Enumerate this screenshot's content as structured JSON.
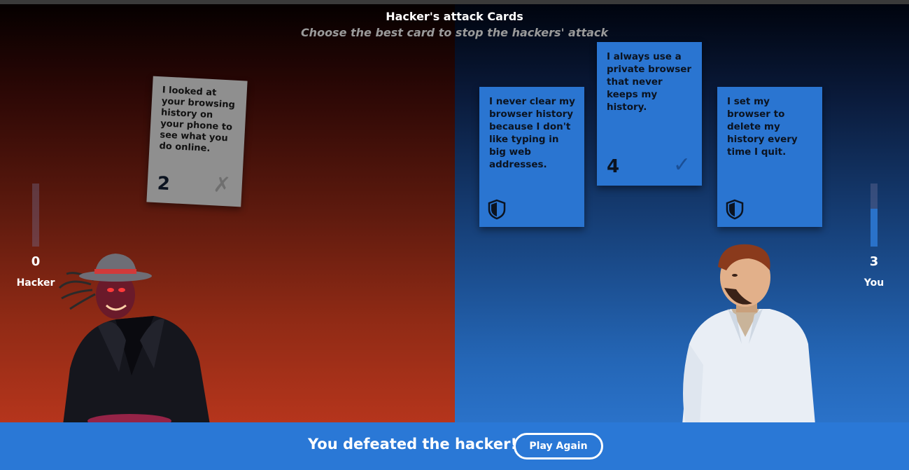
{
  "header": {
    "title": "Hacker's attack Cards",
    "subtitle": "Choose the best card to stop the hackers' attack"
  },
  "players": {
    "hacker": {
      "label": "Hacker",
      "score": "0",
      "level": 0
    },
    "you": {
      "label": "You",
      "score": "3",
      "level": 0.6
    }
  },
  "played_card": {
    "text": "I looked at your browsing history on your phone to see what you do online.",
    "number": "2",
    "mark": "✗"
  },
  "hand": [
    {
      "text": "I never clear my browser history because I don't like typing in big web addresses.",
      "icon": "shield-icon"
    },
    {
      "text": "I always use a private browser that never keeps my history.",
      "number": "4",
      "mark": "✓"
    },
    {
      "text": "I set my browser to delete my history every time I quit.",
      "icon": "shield-icon"
    }
  ],
  "footer": {
    "message": "You defeated the hacker!",
    "button": "Play Again"
  },
  "colors": {
    "card_blue": "#2a75d1",
    "footer_blue": "#2a78d6",
    "hacker_red": "#b5351c",
    "played_card_gray": "#8f8f8f"
  }
}
